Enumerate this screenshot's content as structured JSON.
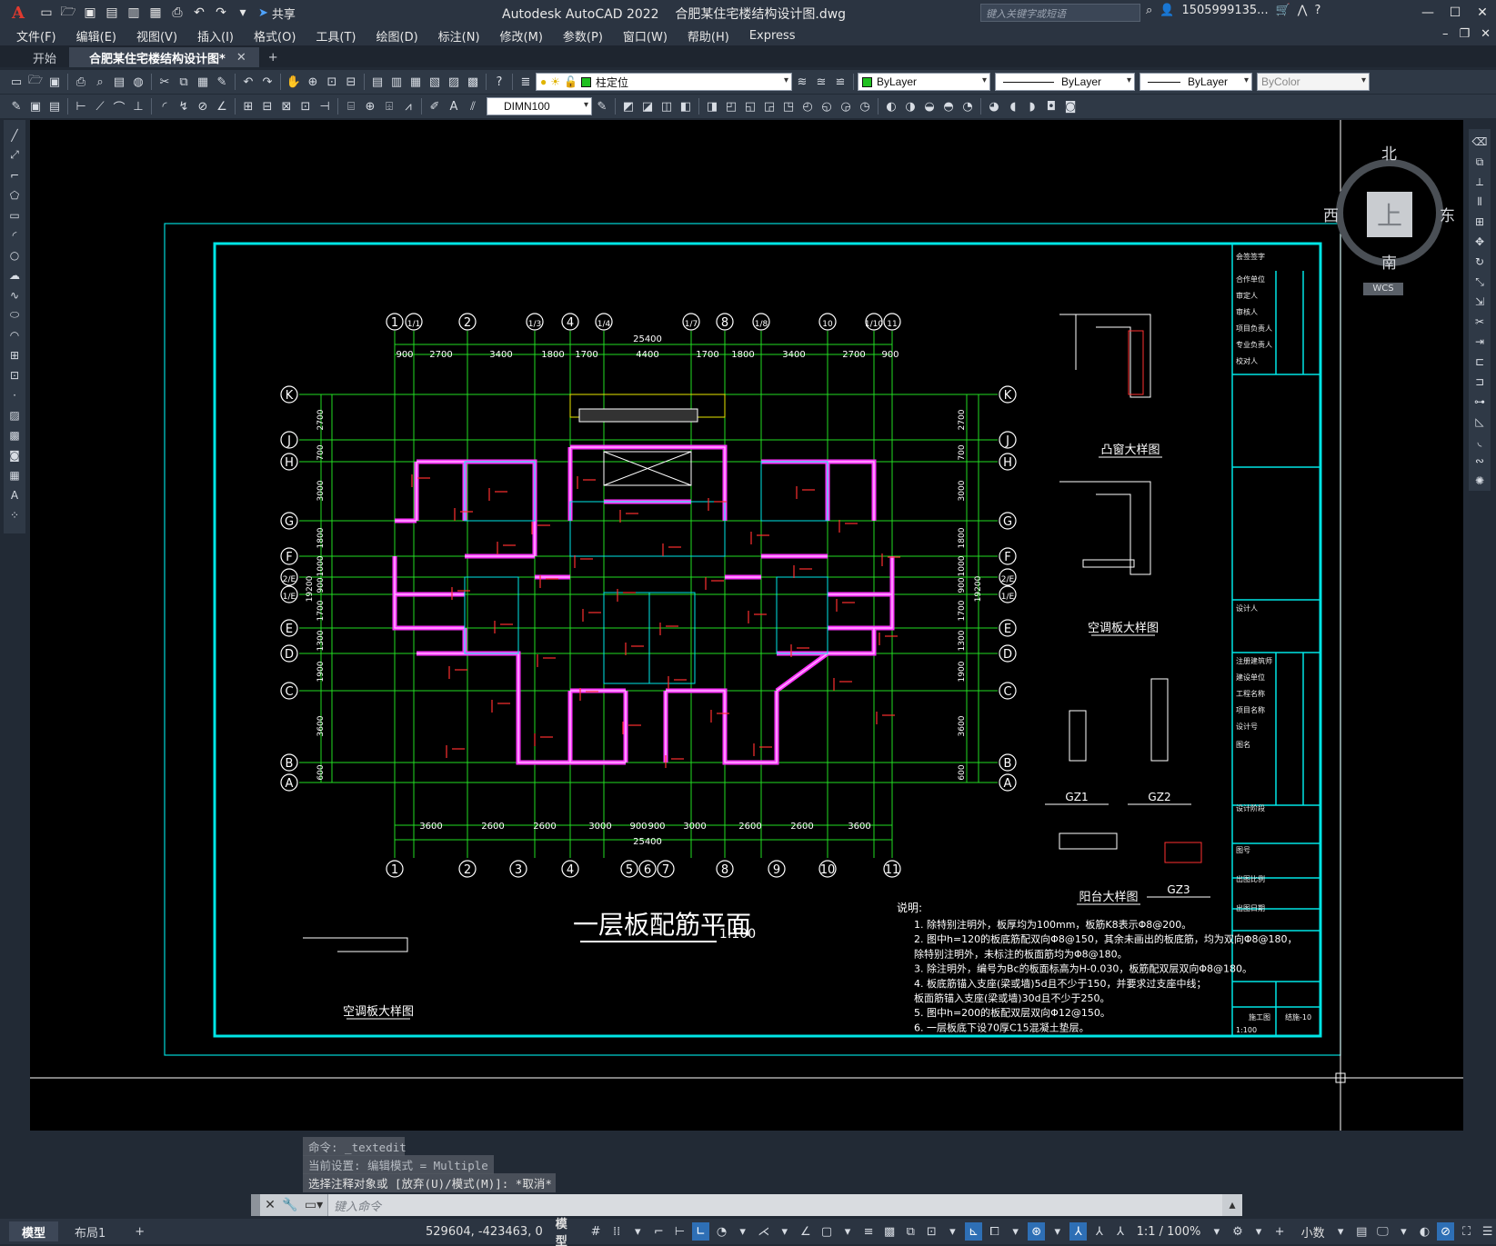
{
  "app": {
    "logo": "A",
    "title": "Autodesk AutoCAD 2022    合肥某住宅楼结构设计图.dwg",
    "share_label": "共享",
    "search_placeholder": "键入关键字或短语",
    "user": "1505999135...",
    "accent_color": "#2e6fb5"
  },
  "menu": [
    "文件(F)",
    "编辑(E)",
    "视图(V)",
    "插入(I)",
    "格式(O)",
    "工具(T)",
    "绘图(D)",
    "标注(N)",
    "修改(M)",
    "参数(P)",
    "窗口(W)",
    "帮助(H)",
    "Express"
  ],
  "file_tabs": [
    {
      "label": "开始",
      "active": false
    },
    {
      "label": "合肥某住宅楼结构设计图*",
      "active": true
    }
  ],
  "layer_combo": "柱定位",
  "color_combo": "ByLayer",
  "linetype_combo": "ByLayer",
  "lineweight_combo": "ByLayer",
  "plotstyle_combo": "ByColor",
  "dimstyle_combo": "DIMN100",
  "viewcube": {
    "north": "北",
    "south": "南",
    "west": "西",
    "east": "东",
    "face": "上",
    "wcs": "WCS"
  },
  "drawing": {
    "main_title": "一层板配筋平面",
    "scale": "1:100",
    "axis_top": [
      "1",
      "1/1",
      "2",
      "1/3",
      "4",
      "1/4",
      "1/7",
      "8",
      "1/8",
      "10",
      "1/10",
      "11"
    ],
    "axis_bottom": [
      "1",
      "2",
      "3",
      "4",
      "5",
      "6",
      "7",
      "8",
      "9",
      "10",
      "11"
    ],
    "axis_left": [
      "K",
      "J",
      "H",
      "G",
      "F",
      "2/E",
      "1/E",
      "E",
      "D",
      "C",
      "B",
      "A"
    ],
    "dims_top": [
      "900",
      "2700",
      "3400",
      "1800",
      "1700",
      "4400",
      "1700",
      "1800",
      "3400",
      "2700",
      "900"
    ],
    "dims_top_total": "25400",
    "dims_bottom": [
      "3600",
      "2600",
      "2600",
      "3000",
      "900",
      "900",
      "3000",
      "2600",
      "2600",
      "3600"
    ],
    "dims_bottom_total": "25400",
    "dims_left": [
      "2700",
      "700",
      "3000",
      "1800",
      "1000",
      "900",
      "1700",
      "1300",
      "1900",
      "3600",
      "600"
    ],
    "dims_left_total": "19200",
    "detail_titles": [
      "凸窗大样图",
      "空调板大样图",
      "GZ1",
      "GZ2",
      "阳台大样图",
      "GZ3",
      "空调板大样图"
    ],
    "notes_title": "说明:",
    "notes": [
      "1. 除特别注明外，板厚均为100mm，板筋K8表示Φ8@200。",
      "2. 图中h=120的板底筋配双向Φ8@150，其余未画出的板底筋，均为双向Φ8@180，",
      "   除特别注明外，未标注的板面筋均为Φ8@180。",
      "3. 除注明外，编号为Bc的板面标高为H-0.030，板筋配双层双向Φ8@180。",
      "4. 板底筋锚入支座(梁或墙)5d且不少于150，并要求过支座中线；",
      "   板面筋锚入支座(梁或墙)30d且不少于250。",
      "5. 图中h=200的板配双层双向Φ12@150。",
      "6. 一层板底下设70厚C15混凝土垫层。"
    ],
    "titleblock": [
      "会签签字",
      "合作单位",
      "审定人",
      "审核人",
      "项目负责人",
      "专业负责人",
      "校对人",
      "设计人",
      "注册建筑师",
      "建设单位",
      "工程名称",
      "项目名称",
      "设计号",
      "图名",
      "设计阶段",
      "图号",
      "出图比例",
      "出图日期"
    ],
    "titleblock_values": {
      "phase": "施工图",
      "sheet": "结施-10",
      "ratio": "1:100"
    }
  },
  "command": {
    "history": [
      "命令: _textedit",
      "当前设置: 编辑模式 = Multiple",
      "选择注释对象或 [放弃(U)/模式(M)]: *取消*"
    ],
    "prompt": "键入命令"
  },
  "layout_tabs": [
    "模型",
    "布局1",
    "+"
  ],
  "status": {
    "coords": "529604, -423463, 0",
    "model": "模型",
    "annoscale": "1:1 / 100%",
    "units": "小数"
  }
}
